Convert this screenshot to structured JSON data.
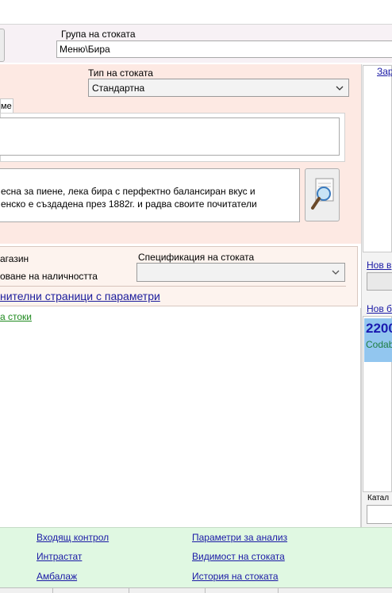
{
  "group": {
    "label": "Група на стоката",
    "value": "Меню\\Бира"
  },
  "type": {
    "label": "Тип на стоката",
    "value": "Стандартна"
  },
  "tab": {
    "label": "ме"
  },
  "description": {
    "line1": "есна за пиене, лека бира с перфектно балансиран вкус и",
    "line2": "енско е създадена през 1882г. и радва своите почитатели"
  },
  "store": {
    "line1": "агазин",
    "line2": "оване на наличността",
    "spec_label": "Спецификация на стоката",
    "pages_link": "нителни страници с параметри",
    "goods_link": "а стоки"
  },
  "right": {
    "top_link": "Зар",
    "new_label1": "Нов в",
    "new_label2": "Нов б",
    "barcode_value": "2200",
    "barcode_type": "Codab",
    "catalog_label": "Катал"
  },
  "bottom_links": [
    {
      "label": "Входящ контрол"
    },
    {
      "label": "Параметри за анализ"
    },
    {
      "label": "Интрастат"
    },
    {
      "label": "Видимост на стоката"
    },
    {
      "label": "Амбалаж"
    },
    {
      "label": "История на стоката"
    }
  ]
}
